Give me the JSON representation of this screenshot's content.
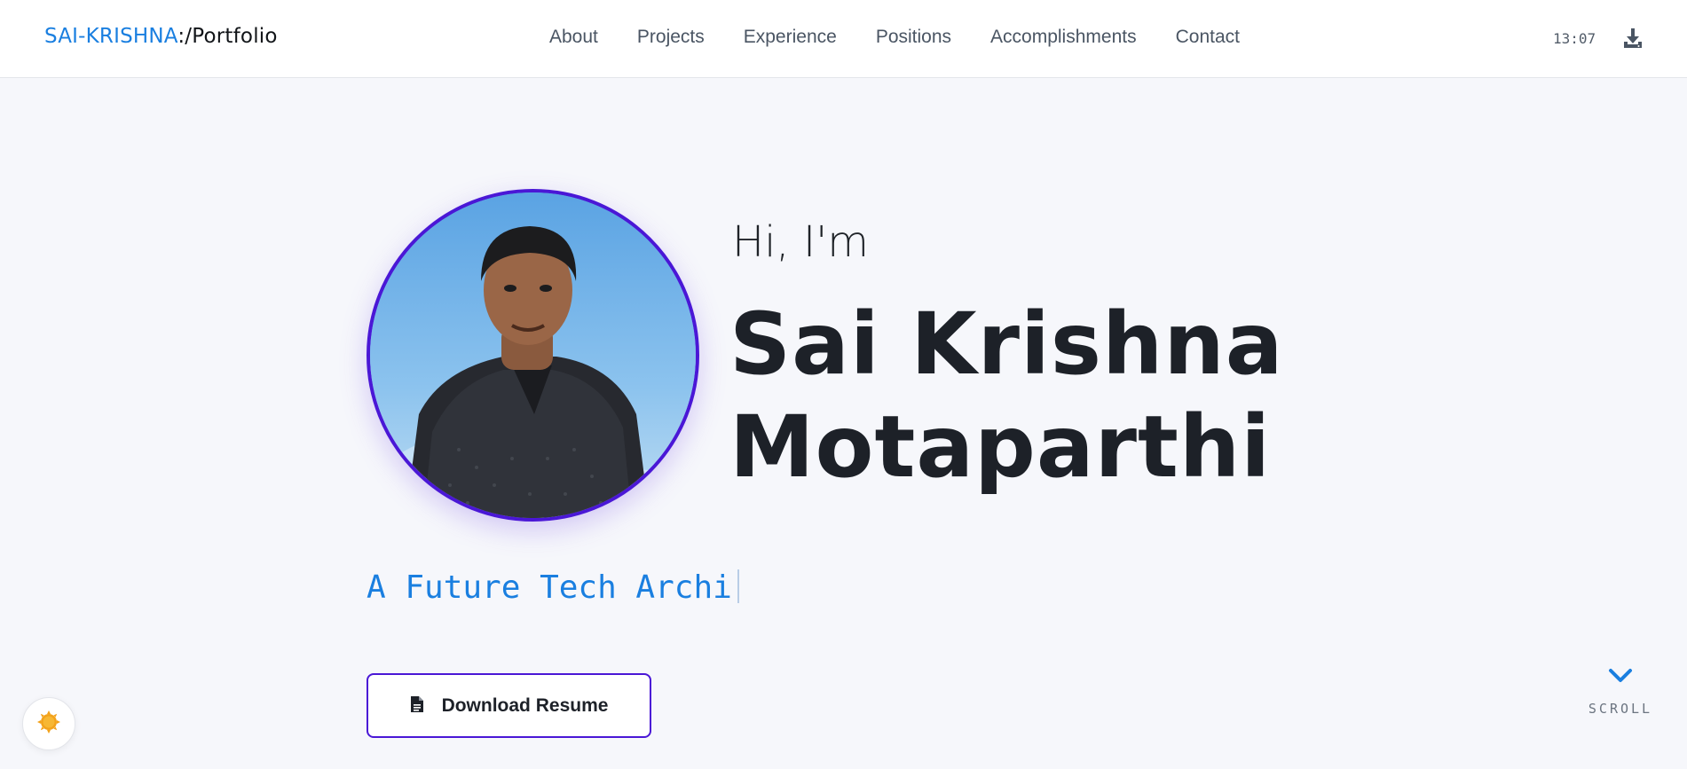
{
  "brand": {
    "part1": "SAI-KRISHNA",
    "part2": ":/Portfolio"
  },
  "nav": {
    "links": [
      {
        "label": "About"
      },
      {
        "label": "Projects"
      },
      {
        "label": "Experience"
      },
      {
        "label": "Positions"
      },
      {
        "label": "Accomplishments"
      },
      {
        "label": "Contact"
      }
    ],
    "clock": "13:07",
    "download_icon": "download-icon"
  },
  "hero": {
    "greeting": "Hi, I'm",
    "first_name": "Sai Krishna",
    "last_name": "Motaparthi",
    "tagline": "A Future Tech Archi",
    "resume_label": "Download Resume",
    "resume_icon": "file-icon",
    "photo": "profile-photo"
  },
  "theme_toggle": {
    "icon": "sun-icon"
  },
  "scroll": {
    "label": "SCROLL",
    "icon": "chevron-down-icon"
  },
  "colors": {
    "accent_blue": "#1a7fe0",
    "accent_purple": "#4a17d6",
    "background": "#f6f7fb",
    "text_dark": "#1d2128"
  }
}
